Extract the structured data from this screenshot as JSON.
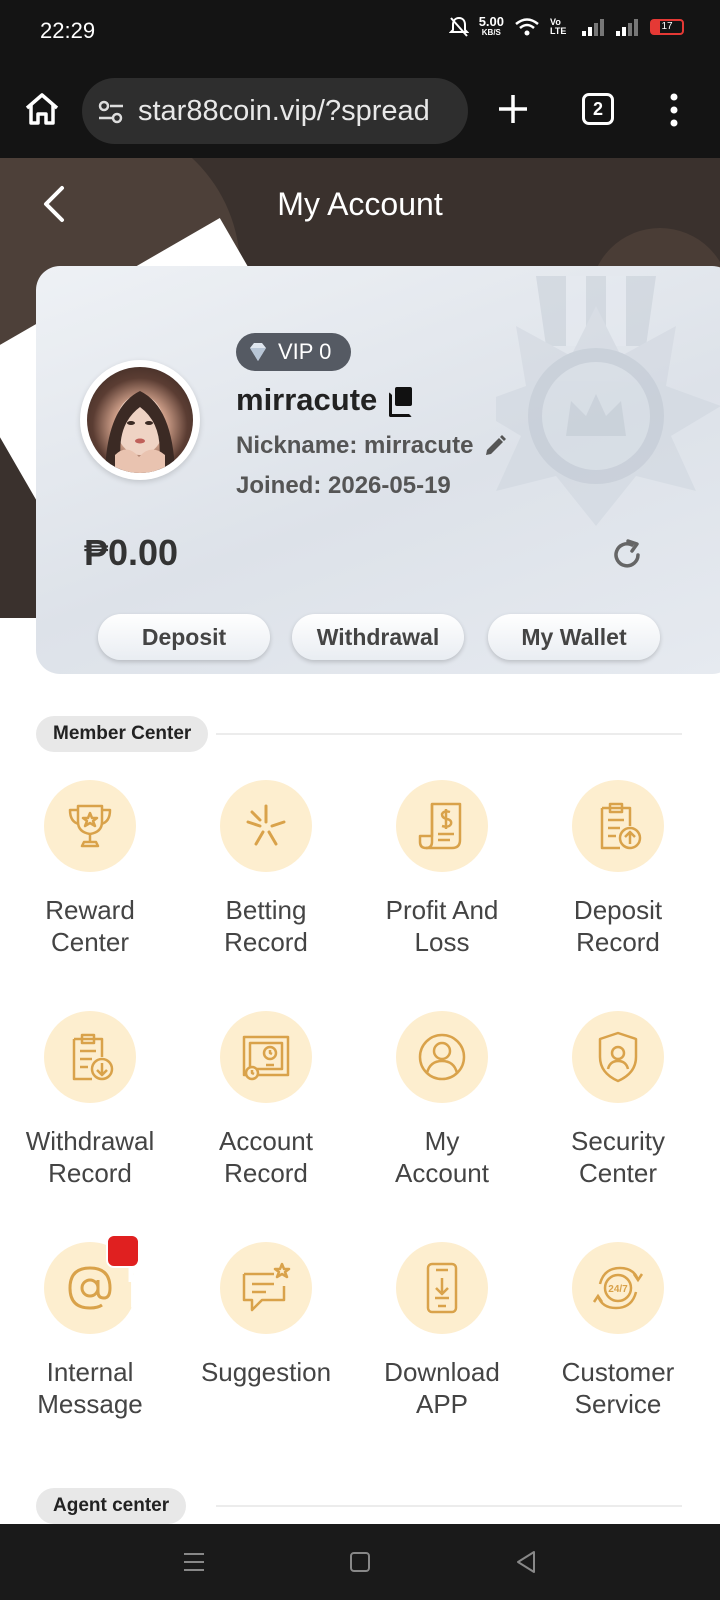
{
  "status_bar": {
    "time": "22:29",
    "net_speed": "5.00",
    "net_speed_unit": "KB/S",
    "volte": "Vo LTE",
    "battery": "17"
  },
  "browser": {
    "url": "star88coin.vip/?spread",
    "tab_count": "2"
  },
  "header": {
    "title": "My Account"
  },
  "account": {
    "vip": "VIP 0",
    "username": "mirracute",
    "nickname": "Nickname: mirracute",
    "joined": "Joined: 2026-05-19",
    "balance": "₱0.00",
    "buttons": {
      "deposit": "Deposit",
      "withdrawal": "Withdrawal",
      "wallet": "My Wallet"
    }
  },
  "member_center": {
    "title": "Member Center",
    "items": [
      {
        "label": "Reward\nCenter",
        "icon": "trophy-icon"
      },
      {
        "label": "Betting\nRecord",
        "icon": "betting-star-icon"
      },
      {
        "label": "Profit And\nLoss",
        "icon": "receipt-dollar-icon"
      },
      {
        "label": "Deposit\nRecord",
        "icon": "clipboard-upload-icon"
      },
      {
        "label": "Withdrawal\nRecord",
        "icon": "clipboard-download-icon"
      },
      {
        "label": "Account\nRecord",
        "icon": "account-record-icon"
      },
      {
        "label": "My\nAccount",
        "icon": "user-circle-icon"
      },
      {
        "label": "Security\nCenter",
        "icon": "shield-user-icon"
      },
      {
        "label": "Internal\nMessage",
        "icon": "at-sign-icon"
      },
      {
        "label": "Suggestion",
        "icon": "chat-star-icon"
      },
      {
        "label": "Download\nAPP",
        "icon": "phone-download-icon"
      },
      {
        "label": "Customer\nService",
        "icon": "support-24-7-icon"
      }
    ]
  },
  "agent_center": {
    "title": "Agent center"
  },
  "colors": {
    "icon_bg": "#fdeecf",
    "icon_stroke": "#d9a24a",
    "header_bg": "#3a312d"
  }
}
